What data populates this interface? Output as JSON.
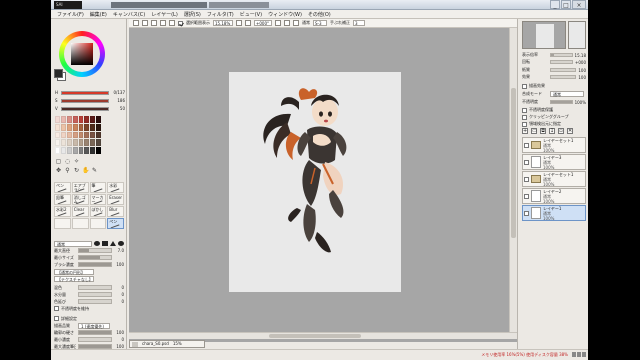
{
  "app": {
    "title_logo": "SAI"
  },
  "window_buttons": [
    "_",
    "□",
    "×"
  ],
  "menu": [
    "ファイル(F)",
    "編集(E)",
    "キャンバス(C)",
    "レイヤー(L)",
    "選択(S)",
    "フィルタ(T)",
    "ビュー(V)",
    "ウィンドウ(W)",
    "その他(O)"
  ],
  "toolbar": {
    "stabilizer_label": "補正",
    "stabilizer_value": "S-3",
    "zoom_value": "15.18%",
    "angle_value": "+000°",
    "blend_label": "通常",
    "hand_label": "手ぶれ補正",
    "hand_value": "3",
    "checkbox_label": "選択範囲表示"
  },
  "left_panel": {
    "colors": {
      "fg": "#2a2a2a",
      "bg": "#ffffff"
    },
    "sliders": [
      {
        "label": "H",
        "value": "0/137",
        "color": "#d63a2a"
      },
      {
        "label": "S",
        "value": "186",
        "color": "#9c3b2e"
      },
      {
        "label": "V",
        "value": "50",
        "color": "#4a2a26"
      }
    ],
    "palette": [
      "#f2d9d4",
      "#e8b8b0",
      "#d98f86",
      "#c5605a",
      "#b84038",
      "#8f2b25",
      "#5a1a17",
      "#2a0d0c",
      "#f6e2d5",
      "#ecc2a8",
      "#dea37f",
      "#c9835c",
      "#a6633f",
      "#7a4429",
      "#4f2b1a",
      "#2b160e",
      "#f8ece4",
      "#f0d4c4",
      "#e6bba3",
      "#d59f82",
      "#c08a6d",
      "#a27058",
      "#7a5343",
      "#52382c",
      "#f7f3ee",
      "#ece3d9",
      "#dcd0c3",
      "#c8b9a9",
      "#b2a08d",
      "#998471",
      "#7a6858",
      "#564a40",
      "#ffffff",
      "#e8e8e8",
      "#cccccc",
      "#a8a8a8",
      "#808080",
      "#585858",
      "#303030",
      "#000000"
    ],
    "brushes": [
      {
        "label": "ペン",
        "selected": false
      },
      {
        "label": "エアブラシ",
        "selected": false
      },
      {
        "label": "筆",
        "selected": false
      },
      {
        "label": "水彩",
        "selected": false
      },
      {
        "label": "鉛筆",
        "selected": false
      },
      {
        "label": "消しゴム",
        "selected": false
      },
      {
        "label": "マーカー",
        "selected": false
      },
      {
        "label": "Eraser",
        "selected": false
      },
      {
        "label": "水彩2",
        "selected": false
      },
      {
        "label": "Clear",
        "selected": false
      },
      {
        "label": "ぼかし",
        "selected": false
      },
      {
        "label": "Blur",
        "selected": false
      },
      {
        "label": "",
        "selected": false
      },
      {
        "label": "",
        "selected": false
      },
      {
        "label": "",
        "selected": false
      },
      {
        "label": "ペン",
        "selected": true
      }
    ],
    "props": {
      "mode": "通常",
      "size_label": "最大直径",
      "size_value": "7.0",
      "size_fill": 0.3,
      "min_size_label": "最小サイズ",
      "min_size_fill": 0.65,
      "density_label": "ブラシ濃度",
      "density_value": "100",
      "density_fill": 1.0,
      "shape_label": "【通常の円形】",
      "texture_label": "【テクスチャなし】",
      "blend_label": "混色",
      "blend_value": "0",
      "water_label": "水分量",
      "water_value": "0",
      "persist_label": "色延び",
      "persist_value": "0",
      "keep_opacity_label": "不透明度を維持",
      "detail_label": "詳細設定",
      "quality_label": "描画品質",
      "quality_value": "1 (速度優先)",
      "edge_label": "輪郭の硬さ",
      "edge_value": "100",
      "min_density_label": "最小濃度",
      "min_density_value": "0",
      "max_pressure_label": "最大濃度筆圧",
      "max_pressure_value": "100",
      "pressure_label": "筆圧 硬⇔軟",
      "pressure_value": "100"
    }
  },
  "canvas": {
    "document_tab": "chara_S0.psd",
    "document_zoom": "15%"
  },
  "right_panel": {
    "zoom_label": "表示倍率",
    "zoom_value": "15.18",
    "angle_label": "回転",
    "angle_value": "+000",
    "effect_label": "紙質",
    "effect_value": "100",
    "texture_label": "効果",
    "texture_value": "100",
    "layer_effect_label": "描画効果",
    "blend_mode_label": "合成モード",
    "blend_mode_value": "通常",
    "opacity_label": "不透明度",
    "opacity_value": "100%",
    "opacity_fill": 1.0,
    "checks": [
      "不透明度保護",
      "クリッピンググループ",
      "領域検出元に指定"
    ],
    "layers": [
      {
        "name": "レイヤーセット1",
        "mode": "通常",
        "opacity": "100%",
        "type": "folder",
        "selected": false
      },
      {
        "name": "レイヤー3",
        "mode": "通常",
        "opacity": "100%",
        "type": "layer",
        "selected": false
      },
      {
        "name": "レイヤーセット1",
        "mode": "通常",
        "opacity": "100%",
        "type": "folder",
        "selected": false
      },
      {
        "name": "レイヤー2",
        "mode": "通常",
        "opacity": "100%",
        "type": "layer",
        "selected": false
      },
      {
        "name": "レイヤー1",
        "mode": "通常",
        "opacity": "100%",
        "type": "layer",
        "selected": true
      }
    ]
  },
  "status": {
    "memory_text": "メモリ使用率 16%(5%) 使用ディスク容量 38%"
  }
}
